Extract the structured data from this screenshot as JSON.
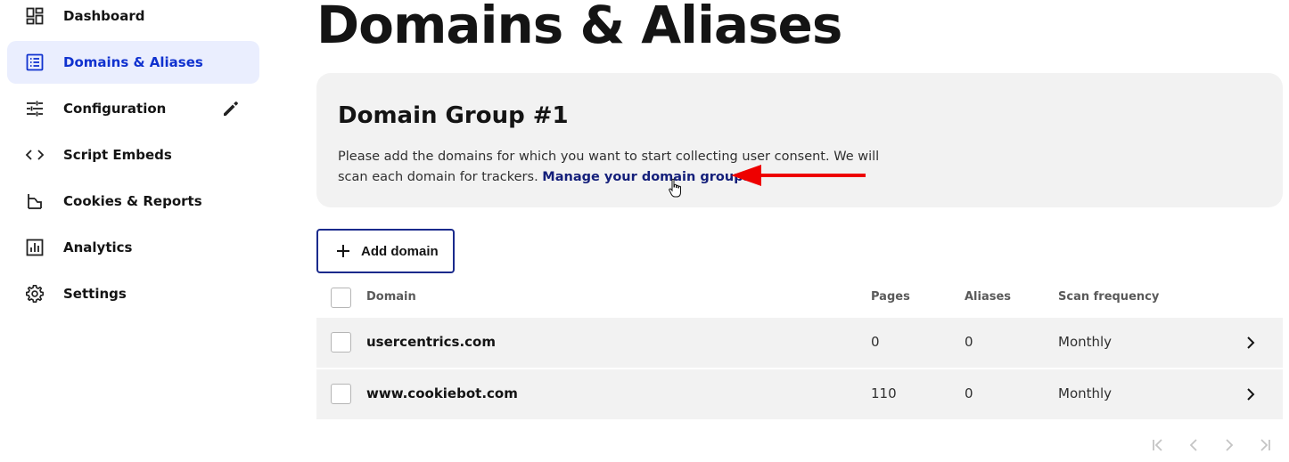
{
  "sidebar": {
    "items": [
      {
        "label": "Dashboard",
        "icon": "dashboard-icon"
      },
      {
        "label": "Domains & Aliases",
        "icon": "list-icon",
        "active": true
      },
      {
        "label": "Configuration",
        "icon": "sliders-icon",
        "action_icon": "pencil-icon"
      },
      {
        "label": "Script Embeds",
        "icon": "code-icon"
      },
      {
        "label": "Cookies & Reports",
        "icon": "cookie-report-icon"
      },
      {
        "label": "Analytics",
        "icon": "bar-chart-icon"
      },
      {
        "label": "Settings",
        "icon": "gear-icon"
      }
    ]
  },
  "main": {
    "title": "Domains & Aliases",
    "group": {
      "title": "Domain Group #1",
      "description": "Please add the domains for which you want to start collecting user consent. We will scan each domain for trackers.",
      "link": "Manage your domain groups"
    },
    "add_button": "Add domain",
    "table": {
      "headers": {
        "domain": "Domain",
        "pages": "Pages",
        "aliases": "Aliases",
        "frequency": "Scan frequency"
      },
      "rows": [
        {
          "domain": "usercentrics.com",
          "pages": "0",
          "aliases": "0",
          "frequency": "Monthly"
        },
        {
          "domain": "www.cookiebot.com",
          "pages": "110",
          "aliases": "0",
          "frequency": "Monthly"
        }
      ]
    }
  },
  "colors": {
    "active_bg": "#eaeefe",
    "active_text": "#1032cf",
    "link": "#141f7a",
    "annotation_arrow": "#ee0000"
  }
}
